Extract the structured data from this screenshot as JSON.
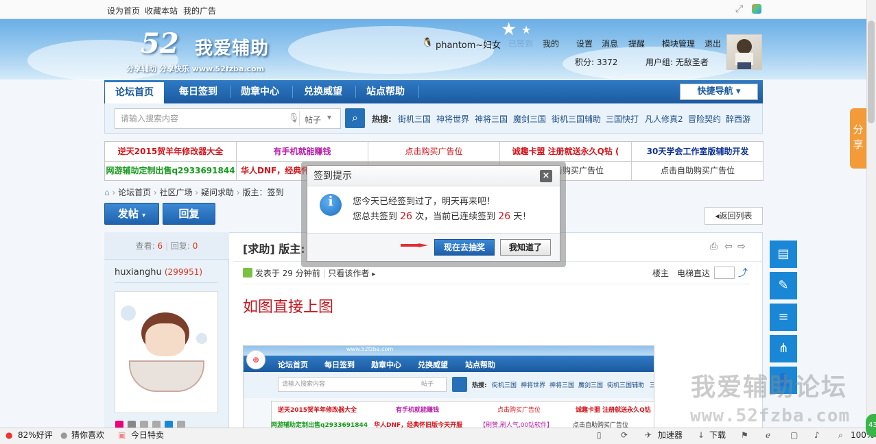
{
  "topbar": {
    "set_home": "设为首页",
    "bookmark": "收藏本站",
    "my_ads": "我的广告"
  },
  "logo": {
    "number": "52",
    "name": "我爱辅助",
    "slogan": "分享辅助  分享快乐  www.52fzba.com"
  },
  "user": {
    "name": "phantom~妇女",
    "signed": "已签到",
    "my": "我的",
    "settings": "设置",
    "messages": "消息",
    "remind": "提醒",
    "modules": "模块管理",
    "logout": "退出",
    "points_label": "积分: 3372",
    "group_label": "用户组: 无敌圣者"
  },
  "nav": {
    "items": [
      "论坛首页",
      "每日签到",
      "勋章中心",
      "兑换威望",
      "站点帮助"
    ],
    "quick": "快捷导航"
  },
  "search": {
    "placeholder": "请输入搜索内容",
    "type": "帖子",
    "hot_label": "热搜:",
    "hot": [
      "街机三国",
      "神将世界",
      "神将三国",
      "魔剑三国",
      "街机三国辅助",
      "三国快打",
      "凡人修真2",
      "冒险契约",
      "醉西游"
    ]
  },
  "ads": {
    "row1": [
      "逆天2015贺羊年修改器大全",
      "有手机就能赚钱",
      "点击购买广告位",
      "诚趣卡盟 注册就送永久Q钻 (",
      "30天学会工作室版辅助开发"
    ],
    "row2": [
      "网游辅助定制出售q2933691844",
      "华人DNF，经典怀旧",
      "",
      "点击购买广告位",
      "点击自助购买广告位"
    ]
  },
  "breadcrumb": {
    "home": "论坛首页",
    "community": "社区广场",
    "help": "疑问求助",
    "current": "版主：签到"
  },
  "buttons": {
    "post": "发帖",
    "reply": "回复",
    "back": "返回列表"
  },
  "thread": {
    "views_label": "查看:",
    "views": "6",
    "replies_label": "回复:",
    "replies": "0",
    "author": "huxianghu",
    "author_id": "(299951)",
    "title": "[求助] 版主:",
    "posted": "发表于 29 分钟前",
    "only_author": "只看该作者",
    "floor": "楼主",
    "jump": "电梯直达",
    "body": "如图直接上图"
  },
  "embedded": {
    "nav": [
      "论坛首页",
      "每日签到",
      "勋章中心",
      "兑换威望",
      "站点帮助"
    ],
    "search_placeholder": "请输入搜索内容",
    "search_type": "帖子",
    "hot_label": "热搜:",
    "hot": [
      "街机三国",
      "神将世界",
      "神将三国",
      "魔剑三国",
      "街机三国辅助",
      "三"
    ],
    "ads_row1": [
      "逆天2015贺羊年修改器大全",
      "有手机就能赚钱",
      "点击购买广告位",
      "诚趣卡盟 注册就送永久Q钻"
    ],
    "ads_row2": [
      "网游辅助定制出售q2933691844",
      "华人DNF，经典怀旧版今天开服",
      "【刷赞,刷人气,00钻软件】",
      "点击自助购买广告位"
    ],
    "url": "www.52fzba.com"
  },
  "dialog": {
    "title": "签到提示",
    "line1": "您今天已经签到过了，明天再来吧！",
    "line2_a": "您总共签到",
    "total": "26",
    "line2_b": "次，当前已连续签到",
    "streak": "26",
    "line2_c": "天！",
    "go": "现在去抽奖",
    "ok": "我知道了"
  },
  "share": "分享",
  "watermark": {
    "line1": "我爱辅助论坛",
    "line2": "www.52fzba.com"
  },
  "statusbar": {
    "rating": "82%好评",
    "guess": "猜你喜欢",
    "deals": "今日特卖",
    "accelerator": "加速器",
    "download": "下载",
    "zoom": "100%",
    "badge": "43"
  },
  "colors": {
    "nav_blue": "#1b5aa0",
    "accent_red": "#c0161e",
    "share_orange": "#f29b38",
    "side_blue": "#1a87d6"
  }
}
